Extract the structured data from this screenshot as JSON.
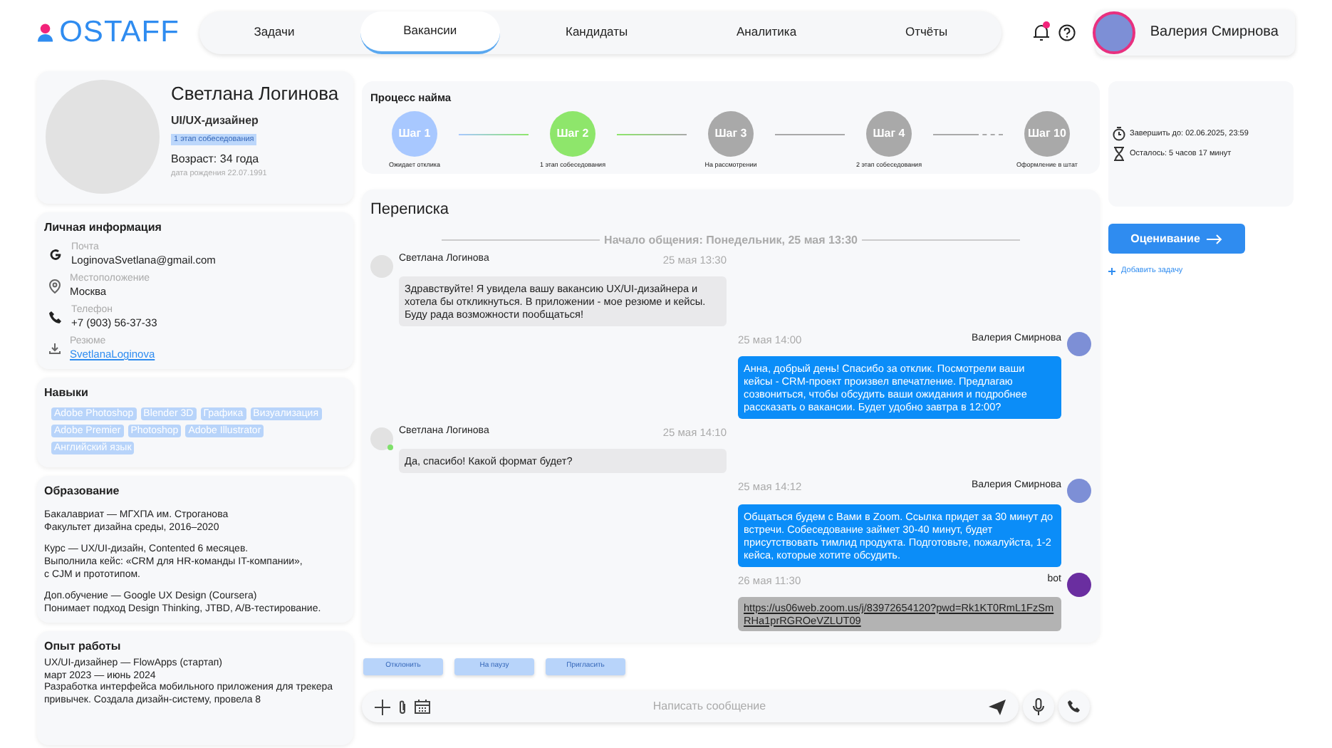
{
  "logo": {
    "text": "OSTAFF"
  },
  "nav": [
    {
      "label": "Задачи",
      "selected": false
    },
    {
      "label": "Вакансии",
      "selected": true
    },
    {
      "label": "Кандидаты",
      "selected": false
    },
    {
      "label": "Аналитика",
      "selected": false
    },
    {
      "label": "Отчёты",
      "selected": false
    }
  ],
  "header": {
    "notification_badge": true,
    "user_name": "Валерия Смирнова"
  },
  "profile": {
    "name": "Светлана Логинова",
    "role": "UI/UX-дизайнер",
    "stage_badge": "1 этап собеседования",
    "age": "Возраст: 34 года",
    "birth_date": "дата рождения 22.07.1991"
  },
  "personal_info": {
    "title": "Личная информация",
    "fields": [
      {
        "kind": "email",
        "label": "Почта",
        "value": "LoginovaSvetlana@gmail.com"
      },
      {
        "kind": "location",
        "label": "Местоположение",
        "value": "Москва"
      },
      {
        "kind": "phone",
        "label": "Телефон",
        "value": "+7 (903) 56-37-33"
      },
      {
        "kind": "resume",
        "label": "Резюме",
        "value": "SvetlanaLoginova"
      }
    ]
  },
  "skills": {
    "title": "Навыки",
    "tags": [
      "Adobe Photoshop",
      "Blender 3D",
      "Графика",
      "Визуализация",
      "Adobe Premier",
      "Photoshop",
      "Adobe Illustrator",
      "Английский язык"
    ]
  },
  "education": {
    "title": "Образование",
    "paragraphs": [
      [
        "Бакалавриат — МГХПА им. Строганова",
        "Факультет дизайна среды, 2016–2020"
      ],
      [
        "Курс — UX/UI-дизайн, Contented 6 месяцев.",
        "Выполнила кейс: «CRM для HR-команды IT-компании»,",
        "с CJM и прототипом."
      ],
      [
        "Доп.обучение — Google UX Design (Coursera)",
        "Понимает подход Design Thinking, JTBD, A/B-тестирование."
      ]
    ]
  },
  "experience": {
    "title": "Опыт работы",
    "lines": [
      "UX/UI-дизайнер — FlowApps (стартап)",
      "март 2023 — июнь 2024",
      "Разработка интерфейса мобильного приложения для трекера",
      "привычек. Создала дизайн-систему, провела 8"
    ]
  },
  "hiring_process": {
    "title": "Процесс найма",
    "steps": [
      {
        "kind": "next",
        "label": "Шаг 1",
        "caption": "Ожидает отклика",
        "color": "#a8c8ff"
      },
      {
        "kind": "next",
        "label": "Шаг 2",
        "caption": "1 этап собеседования",
        "color": "#8ee66b"
      },
      {
        "kind": "next",
        "label": "Шаг 3",
        "caption": "На рассмотрении",
        "color": "#a9a9a9"
      },
      {
        "kind": "next",
        "label": "Шаг 4",
        "caption": "2 этап собеседования",
        "color": "#a9a9a9"
      },
      {
        "kind": "after_gap",
        "label": "Шаг 10",
        "caption": "Оформление в штат",
        "color": "#a9a9a9"
      }
    ]
  },
  "chat": {
    "title": "Переписка",
    "start_divider": "Начало общения: Понедельник, 25 мая 13:30",
    "messages": [
      {
        "kind": "incoming",
        "author": "Светлана Логинова",
        "time": "25 мая 13:30",
        "online": false,
        "text": "Здравствуйте! Я увидела вашу вакансию UX/UI-дизайнера и хотела бы откликнуться. В приложении - мое резюме и кейсы. Буду рада возможности пообщаться!"
      },
      {
        "kind": "outgoing",
        "author": "Валерия Смирнова",
        "time": "25 мая 14:00",
        "online": false,
        "text": "Анна, добрый день! Спасибо за отклик. Посмотрели ваши кейсы - CRM-проект произвел впечатление. Предлагаю созвониться, чтобы обсудить ваши ожидания и подробнее рассказать о вакансии. Будет удобно завтра в 12:00?"
      },
      {
        "kind": "incoming",
        "author": "Светлана Логинова",
        "time": "25 мая 14:10",
        "online": true,
        "text": "Да, спасибо! Какой формат будет?"
      },
      {
        "kind": "outgoing",
        "author": "Валерия Смирнова",
        "time": "25 мая 14:12",
        "online": false,
        "text": "Общаться будем с Вами в Zoom. Ссылка придет за 30 минут до встречи. Собеседование займет 30-40 минут, будет присутствовать тимлид продукта. Подготовьте, пожалуйста, 1-2 кейса, которые хотите обсудить."
      },
      {
        "kind": "bot_link",
        "author": "bot",
        "time": "26 мая 11:30",
        "online": false,
        "text": "https://us06web.zoom.us/j/83972654120?pwd=Rk1KT0RmL1FzSmRHa1prRGROeVZLUT09"
      }
    ]
  },
  "actions": [
    "Отклонить",
    "На паузу",
    "Пригласить"
  ],
  "composer": {
    "placeholder": "Написать сообщение"
  },
  "deadline": {
    "due": "Завершить до: 02.06.2025, 23:59",
    "remaining": "Осталось: 5 часов 17 минут"
  },
  "evaluate_button": "Оценивание",
  "add_task": "Добавить задачу"
}
